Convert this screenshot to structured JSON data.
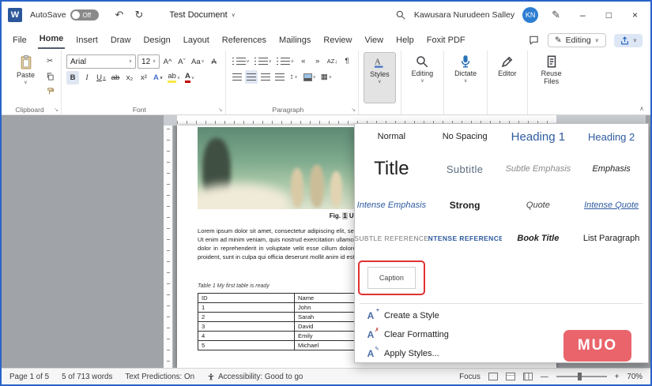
{
  "titlebar": {
    "autosave_label": "AutoSave",
    "autosave_state": "Off",
    "doc_title": "Test Document",
    "user_name": "Kawusara Nurudeen Salley",
    "user_initials": "KN"
  },
  "menubar": {
    "tabs": [
      "File",
      "Home",
      "Insert",
      "Draw",
      "Design",
      "Layout",
      "References",
      "Mailings",
      "Review",
      "View",
      "Help",
      "Foxit PDF"
    ],
    "mode_label": "Editing"
  },
  "ribbon": {
    "paste_label": "Paste",
    "font_name": "Arial",
    "font_size": "12",
    "groups": {
      "clipboard": "Clipboard",
      "font": "Font",
      "paragraph": "Paragraph"
    },
    "big_buttons": {
      "styles": "Styles",
      "editing": "Editing",
      "dictate": "Dictate",
      "editor": "Editor",
      "reuse": "Reuse Files"
    }
  },
  "icons": {
    "word_logo": "W",
    "undo": "↶",
    "redo": "↻",
    "chevron": "∨",
    "pen": "✎",
    "minimize": "–",
    "maximize": "□",
    "close": "×",
    "bold": "B",
    "italic": "I",
    "underline": "U",
    "strikethrough": "ab",
    "subscript": "x₂",
    "superscript": "x²",
    "text_effects": "A",
    "highlight": "ab",
    "font_color": "A",
    "change_case": "Aa",
    "grow_font": "A^",
    "shrink_font": "Aˇ",
    "clear_format": "A",
    "cut": "✂",
    "outdent": "«",
    "indent": "»",
    "sort": "AZ↓",
    "pilcrow": "¶",
    "line_spacing": "↕",
    "borders": "▦",
    "letter_a": "A",
    "plus": "+",
    "clear_x": "✗",
    "apply_pen": "✎",
    "zoom_out": "—",
    "zoom_in": "+",
    "collapse": "∧"
  },
  "styles_panel": {
    "gallery": [
      "Normal",
      "No Spacing",
      "Heading 1",
      "Heading 2",
      "Title",
      "Subtitle",
      "Subtle Emphasis",
      "Emphasis",
      "Intense Emphasis",
      "Strong",
      "Quote",
      "Intense Quote",
      "Subtle Reference",
      "Intense Reference",
      "Book Title",
      "List Paragraph",
      "Caption"
    ],
    "menu": [
      "Create a Style",
      "Clear Formatting",
      "Apply Styles..."
    ]
  },
  "document": {
    "figure_caption_prefix": "Fig. ",
    "figure_number": "1",
    "figure_caption_text": " United we stand",
    "body_text": "Lorem ipsum dolor sit amet, consectetur adipiscing elit, sed do eiusmod tempor incididunt ut labore et dolore magna aliqua. Ut enim ad minim veniam, quis nostrud exercitation ullamco laboris nisi ut aliquip ex ea commodo consequat. Duis aute irure dolor in reprehenderit in voluptate velit esse cillum dolore eu fugiat nulla pariatur. Excepteur sint occaecat cupidatat non proident, sunt in culpa qui officia deserunt mollit anim id est laborum.",
    "table_caption": "Table 1 My first table is ready",
    "table_headers": [
      "ID",
      "Name"
    ],
    "table_rows": [
      [
        "1",
        "John"
      ],
      [
        "2",
        "Sarah"
      ],
      [
        "3",
        "David"
      ],
      [
        "4",
        "Emily"
      ],
      [
        "5",
        "Michael"
      ]
    ]
  },
  "statusbar": {
    "page_info": "Page 1 of 5",
    "word_count": "5 of 713 words",
    "predictions": "Text Predictions: On",
    "accessibility": "Accessibility: Good to go",
    "focus": "Focus",
    "zoom": "70%"
  },
  "watermark": "MUO"
}
